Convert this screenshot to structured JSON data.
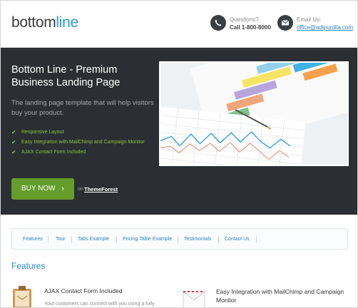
{
  "header": {
    "logo_main": "bottom",
    "logo_accent": "line",
    "questions_label": "Questions?",
    "phone": "Call 1-800-8000",
    "email_label": "Email Us:",
    "email": "office@adipurdila.com"
  },
  "hero": {
    "title": "Bottom Line - Premium Business Landing Page",
    "subtitle": "The landing page template that will help visitors buy your product.",
    "features": [
      "Responsive Layout",
      "Easy Integration with MailChimp and Campaign Monitor",
      "AJAX Contact Form Included"
    ],
    "buy_button": "BUY NOW",
    "buy_arrow": "›",
    "on_text": "on",
    "marketplace_link": "ThemeForest"
  },
  "nav": {
    "items": [
      "Features",
      "Tour",
      "Tabs Example",
      "Pricing Table Example",
      "Testimonials",
      "Contact Us"
    ]
  },
  "features": {
    "title": "Features",
    "items": [
      {
        "title": "AJAX Contact Form Included",
        "text": "Your customers can connect with you using a fully",
        "icon": "contact-form-icon"
      },
      {
        "title": "Easy Integration with MailChimp and Campaign Monitor",
        "text": "",
        "icon": "mail-envelope-icon"
      }
    ]
  },
  "colors": {
    "accent_blue": "#2a9ad2",
    "hero_bg": "#2b2f33",
    "green": "#8ec23d",
    "button_green": "#659e2b"
  }
}
